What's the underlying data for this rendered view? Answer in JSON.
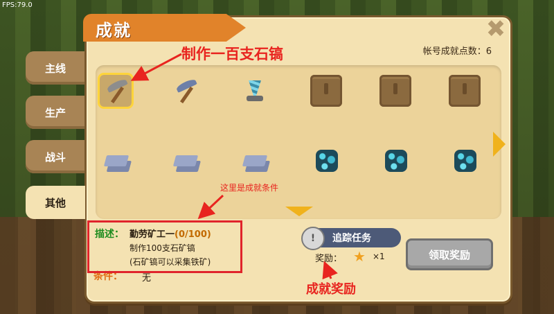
{
  "hud": {
    "fps": "FPS:79.0"
  },
  "panel": {
    "title": "成就",
    "close_symbol": "✖",
    "points_label": "帐号成就点数：6"
  },
  "tabs": [
    {
      "label": "主线",
      "active": false
    },
    {
      "label": "生产",
      "active": false
    },
    {
      "label": "战斗",
      "active": false
    },
    {
      "label": "其他",
      "active": true
    }
  ],
  "grid": {
    "row1": [
      "stone-pickaxe",
      "iron-pickaxe",
      "diamond-drill",
      "locked",
      "locked",
      "locked"
    ],
    "row2": [
      "iron-ingot",
      "iron-ingot",
      "iron-ingot",
      "blue-ore",
      "blue-ore",
      "blue-ore"
    ],
    "selected": "stone-pickaxe"
  },
  "detail": {
    "desc_label": "描述：",
    "title_text": "勤劳矿工一",
    "progress": "(0/100)",
    "line1": "制作100支石矿镐",
    "line2": "(石矿镐可以采集铁矿)",
    "condition_label": "条件：",
    "condition_value": "无"
  },
  "actions": {
    "track_label": "追踪任务",
    "track_knob": "!",
    "reward_label": "奖励：",
    "reward_count": "×1",
    "claim_label": "领取奖励"
  },
  "annotations": {
    "a1": "制作一百支石镐",
    "a2": "这里是成就条件",
    "a3": "成就奖励"
  },
  "colors": {
    "accent_orange": "#e1832a",
    "annotation_red": "#e8241f",
    "highlight": "#ffd43a"
  }
}
